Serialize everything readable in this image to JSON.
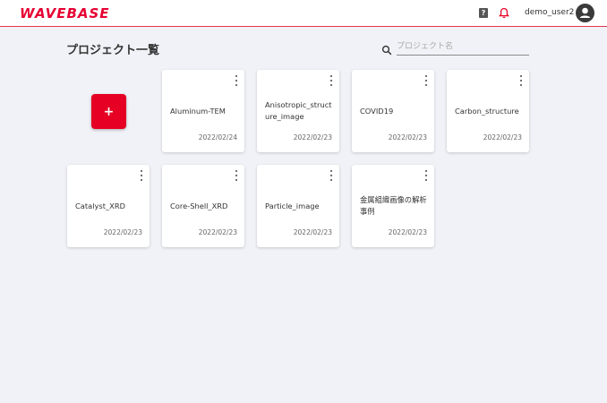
{
  "header": {
    "logo": "WAVEBASE",
    "help_glyph": "?",
    "username": "demo_user2",
    "icons": {
      "help": "help-icon",
      "notifications": "bell-icon",
      "account": "avatar-icon"
    },
    "accent_color": "#e60023"
  },
  "main": {
    "title": "プロジェクト一覧",
    "search": {
      "placeholder": "プロジェクト名",
      "value": ""
    },
    "add_button_label": "+",
    "projects": [
      {
        "name": "Aluminum-TEM",
        "date": "2022/02/24"
      },
      {
        "name": "Anisotropic_structure_image",
        "date": "2022/02/23"
      },
      {
        "name": "COVID19",
        "date": "2022/02/23"
      },
      {
        "name": "Carbon_structure",
        "date": "2022/02/23"
      },
      {
        "name": "Catalyst_XRD",
        "date": "2022/02/23"
      },
      {
        "name": "Core-Shell_XRD",
        "date": "2022/02/23"
      },
      {
        "name": "Particle_image",
        "date": "2022/02/23"
      },
      {
        "name": "金属組織画像の解析事例",
        "date": "2022/02/23"
      }
    ]
  }
}
